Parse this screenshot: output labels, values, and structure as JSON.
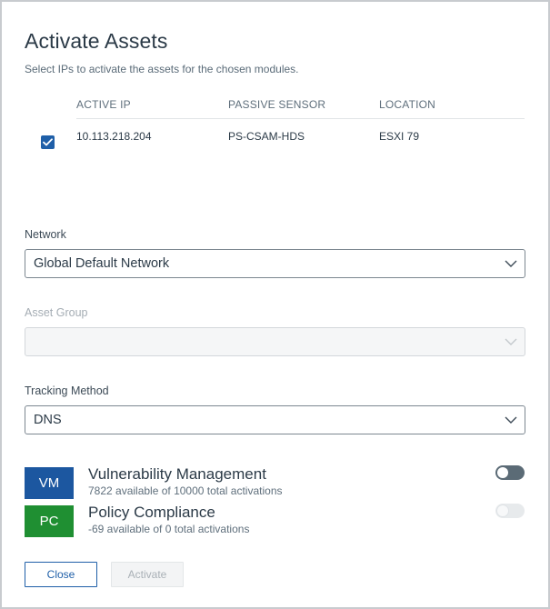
{
  "dialog": {
    "title": "Activate Assets",
    "subtitle": "Select IPs to activate the assets for the chosen modules."
  },
  "table": {
    "headers": [
      "ACTIVE IP",
      "PASSIVE SENSOR",
      "LOCATION"
    ],
    "rows": [
      {
        "checked": true,
        "ip": "10.113.218.204",
        "sensor": "PS-CSAM-HDS",
        "location": "ESXI 79"
      }
    ]
  },
  "fields": {
    "network": {
      "label": "Network",
      "value": "Global Default Network"
    },
    "asset_group": {
      "label": "Asset Group",
      "value": "",
      "disabled": true
    },
    "tracking_method": {
      "label": "Tracking Method",
      "value": "DNS"
    }
  },
  "modules": [
    {
      "badge": "VM",
      "name": "Vulnerability Management",
      "detail": "7822 available of 10000 total activations",
      "enabled": true,
      "color": "#1c57a0"
    },
    {
      "badge": "PC",
      "name": "Policy Compliance",
      "detail": "-69 available of 0 total activations",
      "enabled": false,
      "color": "#1f8f32"
    }
  ],
  "buttons": {
    "close": "Close",
    "activate": "Activate"
  },
  "icons": {
    "checkbox": "check-icon",
    "dropdown": "chevron-down-icon"
  }
}
